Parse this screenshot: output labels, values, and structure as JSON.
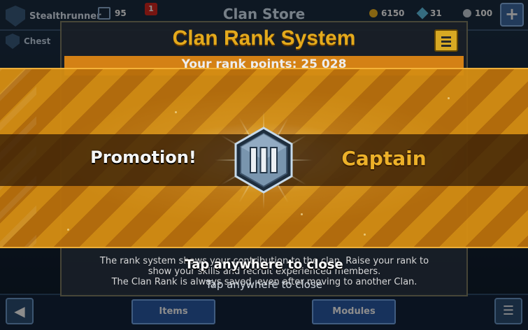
{
  "background": {
    "player_name": "Stealthrunner",
    "level": "95",
    "notification_count": "1",
    "store_title": "Clan Store",
    "coins": "6150",
    "gems": "31",
    "tickets": "100",
    "tab_chest": "Chest",
    "bottom_hint": "Tap anywhere to close",
    "tabs": [
      "Items",
      "Modules"
    ]
  },
  "panel": {
    "title": "Clan Rank System",
    "rank_points": "Your rank points: 25 028",
    "desc_line1": "The rank system shows your contribution to the clan. Raise your rank to",
    "desc_line2": "show your skills and recruit experienced members.",
    "desc_line3": "The Clan Rank is always saved, even after moving to another Clan."
  },
  "promotion": {
    "label": "Promotion!",
    "rank": "Captain",
    "badge_numeral": "III",
    "close_hint": "Tap anywhere to close"
  },
  "colors": {
    "accent_gold": "#f6b72a",
    "banner_orange": "#d48d13",
    "badge_steel": "#7d9ab4"
  }
}
